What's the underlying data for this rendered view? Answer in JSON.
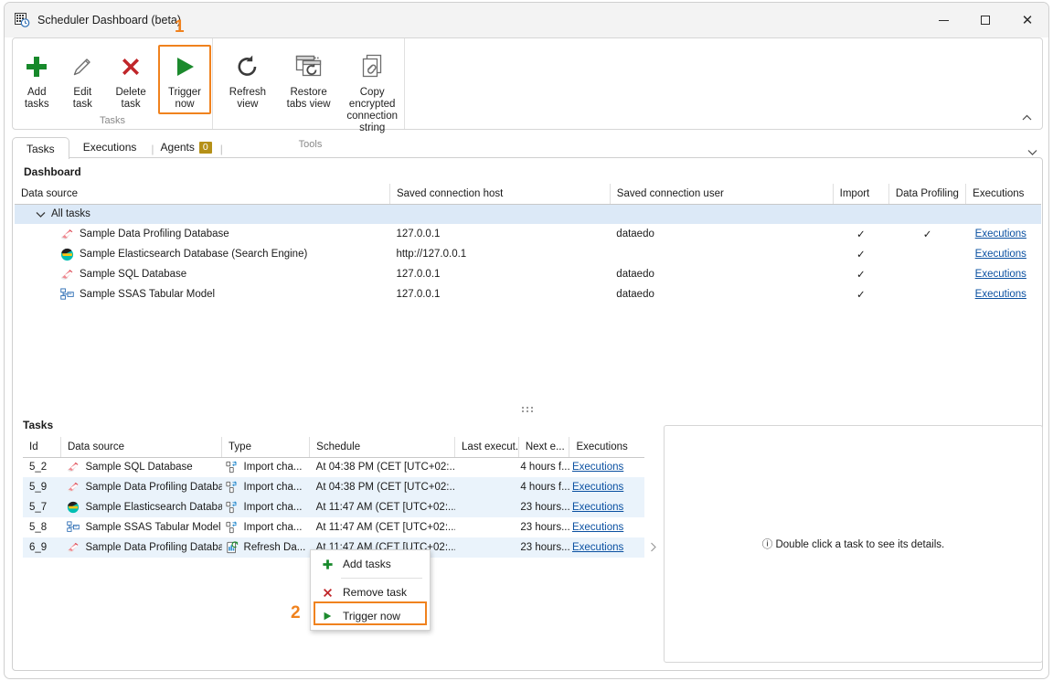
{
  "window": {
    "title": "Scheduler Dashboard (beta)",
    "icon": "scheduler-icon",
    "minimize_label": "Minimize",
    "maximize_label": "Maximize",
    "close_label": "Close"
  },
  "annotations": [
    {
      "id": "1",
      "label": "1"
    },
    {
      "id": "2",
      "label": "2"
    }
  ],
  "ribbon": {
    "groups": [
      {
        "name": "Tasks",
        "label": "Tasks",
        "items": [
          {
            "icon": "plus-icon",
            "label": "Add tasks",
            "highlight": false
          },
          {
            "icon": "pencil-icon",
            "label": "Edit task",
            "highlight": false
          },
          {
            "icon": "cross-icon",
            "label": "Delete task",
            "highlight": false
          },
          {
            "icon": "play-icon",
            "label": "Trigger now",
            "highlight": true
          }
        ]
      },
      {
        "name": "Tools",
        "label": "Tools",
        "items": [
          {
            "icon": "refresh-icon",
            "label": "Refresh view",
            "highlight": false
          },
          {
            "icon": "restore-tabs-icon",
            "label": "Restore tabs view",
            "highlight": false
          },
          {
            "icon": "copy-link-icon",
            "label": "Copy encrypted connection string",
            "highlight": false
          }
        ]
      }
    ],
    "collapse_icon": "chevron-up-icon"
  },
  "tabs": {
    "items": [
      {
        "label": "Tasks",
        "active": true,
        "badge": null
      },
      {
        "label": "Executions",
        "active": false,
        "badge": null
      },
      {
        "label": "Agents",
        "active": false,
        "badge": "0"
      }
    ],
    "expand_icon": "chevron-down-icon"
  },
  "dashboard": {
    "title": "Dashboard",
    "columns": [
      "Data source",
      "Saved connection host",
      "Saved connection user",
      "Import",
      "Data Profiling",
      "Executions"
    ],
    "group_row": {
      "label": "All tasks",
      "expander": "chevron-down-icon"
    },
    "rows": [
      {
        "icon": "sqlserver-icon",
        "data_source": "Sample Data Profiling Database",
        "host": "127.0.0.1",
        "user": "dataedo",
        "import": "✓",
        "data_profiling": "✓",
        "executions": "Executions"
      },
      {
        "icon": "elasticsearch-icon",
        "data_source": "Sample Elasticsearch Database (Search Engine)",
        "host": "http://127.0.0.1",
        "user": "",
        "import": "✓",
        "data_profiling": "",
        "executions": "Executions"
      },
      {
        "icon": "sqlserver-icon",
        "data_source": "Sample SQL Database",
        "host": "127.0.0.1",
        "user": "dataedo",
        "import": "✓",
        "data_profiling": "",
        "executions": "Executions"
      },
      {
        "icon": "ssas-icon",
        "data_source": "Sample SSAS Tabular Model",
        "host": "127.0.0.1",
        "user": "dataedo",
        "import": "✓",
        "data_profiling": "",
        "executions": "Executions"
      }
    ]
  },
  "tasks": {
    "title": "Tasks",
    "columns": [
      "Id",
      "Data source",
      "Type",
      "Schedule",
      "Last execut...",
      "Next e...",
      "Executions"
    ],
    "rows": [
      {
        "id": "5_2",
        "icon": "sqlserver-icon",
        "data_source": "Sample SQL Database",
        "type_icon": "import-changes-icon",
        "type": "Import cha...",
        "schedule": "At 04:38 PM (CET [UTC+02:...",
        "last_execution": "",
        "next_execution": "4 hours f...",
        "executions": "Executions"
      },
      {
        "id": "5_9",
        "icon": "sqlserver-icon",
        "data_source": "Sample Data Profiling Database",
        "type_icon": "import-changes-icon",
        "type": "Import cha...",
        "schedule": "At 04:38 PM (CET [UTC+02:...",
        "last_execution": "",
        "next_execution": "4 hours f...",
        "executions": "Executions"
      },
      {
        "id": "5_7",
        "icon": "elasticsearch-icon",
        "data_source": "Sample Elasticsearch Databas...",
        "type_icon": "import-changes-icon",
        "type": "Import cha...",
        "schedule": "At 11:47 AM (CET [UTC+02:...",
        "last_execution": "",
        "next_execution": "23 hours...",
        "executions": "Executions"
      },
      {
        "id": "5_8",
        "icon": "ssas-icon",
        "data_source": "Sample SSAS Tabular Model",
        "type_icon": "import-changes-icon",
        "type": "Import cha...",
        "schedule": "At 11:47 AM (CET [UTC+02:...",
        "last_execution": "",
        "next_execution": "23 hours...",
        "executions": "Executions"
      },
      {
        "id": "6_9",
        "icon": "sqlserver-icon",
        "data_source": "Sample Data Profiling Database",
        "type_icon": "refresh-data-icon",
        "type": "Refresh Da...",
        "schedule": "At 11:47 AM (CET [UTC+02:...",
        "last_execution": "",
        "next_execution": "23 hours...",
        "executions": "Executions"
      }
    ]
  },
  "details": {
    "placeholder": "ⓘ Double click a task to see its details."
  },
  "context_menu": {
    "items": [
      {
        "icon": "plus-icon",
        "label": "Add tasks",
        "highlight": false,
        "separator_after": true
      },
      {
        "icon": "cross-icon",
        "label": "Remove task",
        "highlight": false,
        "separator_after": false
      },
      {
        "icon": "play-icon",
        "label": "Trigger now",
        "highlight": true,
        "separator_after": false
      }
    ]
  },
  "colors": {
    "accent_highlight": "#f0821e",
    "link": "#0a50a1",
    "row_alt": "#eaf3fb",
    "group_row": "#dce9f7",
    "badge": "#b59017",
    "green": "#17892b",
    "red": "#c0262a"
  }
}
